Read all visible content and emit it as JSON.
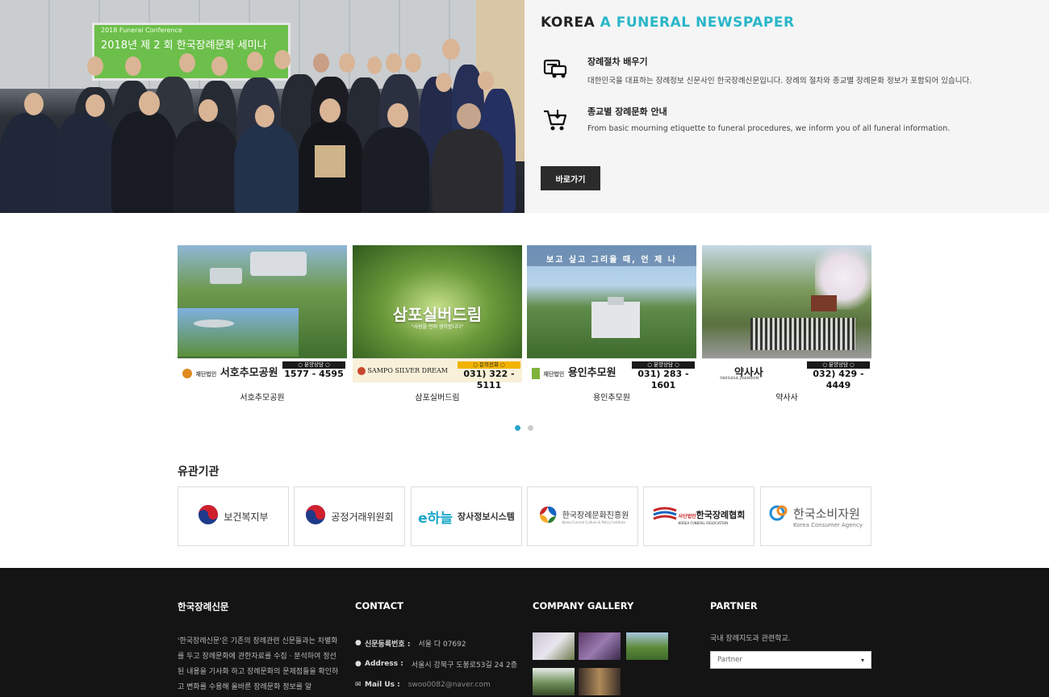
{
  "hero": {
    "title_main": "KOREA",
    "title_accent": "A FUNERAL NEWSPAPER",
    "photo_banner_small": "2018 Funeral Conference",
    "photo_banner": "2018년 제 2 회 한국장례문화 세미나",
    "features": [
      {
        "icon": "car-icon",
        "title": "장례절차 배우기",
        "desc": "대한민국을 대표하는 장례정보 신문사인 한국장례신문입니다. 장례의 절차와 종교별 장례문화 정보가 포함되어 있습니다."
      },
      {
        "icon": "cart-icon",
        "title": "종교별 장례문화 안내",
        "desc": "From basic mourning etiquette to funeral procedures, we inform you of all funeral information."
      }
    ],
    "button_label": "바로가기"
  },
  "carousel": {
    "items": [
      {
        "name_on_image": "서호추모공원",
        "prefix": "재단법인",
        "tag": "○ 분양상담 ○",
        "phone": "1577 - 4595",
        "caption": "서호추모공원"
      },
      {
        "name_on_image": "SAMPO SILVER DREAM",
        "overlay_title": "삼포실버드림",
        "overlay_sub": "\"사람을 먼저 생각합니다\"",
        "tag": "○ 문의전화 ○",
        "phone": "031) 322 - 5111",
        "caption": "삼포실버드림"
      },
      {
        "name_on_image": "용인추모원",
        "prefix": "재단법인",
        "overlay_title": "보고 싶고 그리울 때, 언 제 나",
        "tag": "○ 분양상담 ○",
        "phone": "031) 283 - 1601",
        "caption": "용인추모원"
      },
      {
        "name_on_image": "약사사",
        "sub": "YAKSASA JUANGUN",
        "tag": "○ 분양상담 ○",
        "phone": "032) 429 - 4449",
        "caption": "약사사"
      }
    ],
    "active_dot": 0,
    "dot_count": 2
  },
  "related": {
    "title": "유관기관",
    "logos": [
      {
        "name": "보건복지부"
      },
      {
        "name": "공정거래위원회"
      },
      {
        "name": "장사정보시스템",
        "brand": "e하늘"
      },
      {
        "name": "한국장례문화진흥원",
        "sub": "Korea Funeral Culture & Policy Institute"
      },
      {
        "name": "한국장례협회",
        "prefix": "사단법인",
        "sub": "KOREA FUNERAL ASSOCIATION"
      },
      {
        "name": "한국소비자원",
        "sub": "Korea Consumer Agency"
      }
    ]
  },
  "footer": {
    "about_title": "한국장례신문",
    "about_text": "'한국장례신문'은 기존의 장례관련 신문들과는 차별화를 두고 장례문화에 관한자료를 수집 · 분석하여 정선된 내용을 기사화 하고 장례문화의 문제점들을 확인하고 변화를 수용해 올바른 장례문화 정보를 알",
    "contact_title": "CONTACT",
    "contact": [
      {
        "key": "신문등록번호 :",
        "value": "서울 다 07692"
      },
      {
        "key": "Address :",
        "value": "서울시 강북구 도봉로53길 24 2층"
      },
      {
        "key": "Mail Us :",
        "value": "swoo0082@naver.com"
      }
    ],
    "gallery_title": "COMPANY GALLERY",
    "partner_title": "PARTNER",
    "partner_text": "국내 장례지도과 관련학교.",
    "partner_select": "Partner"
  }
}
